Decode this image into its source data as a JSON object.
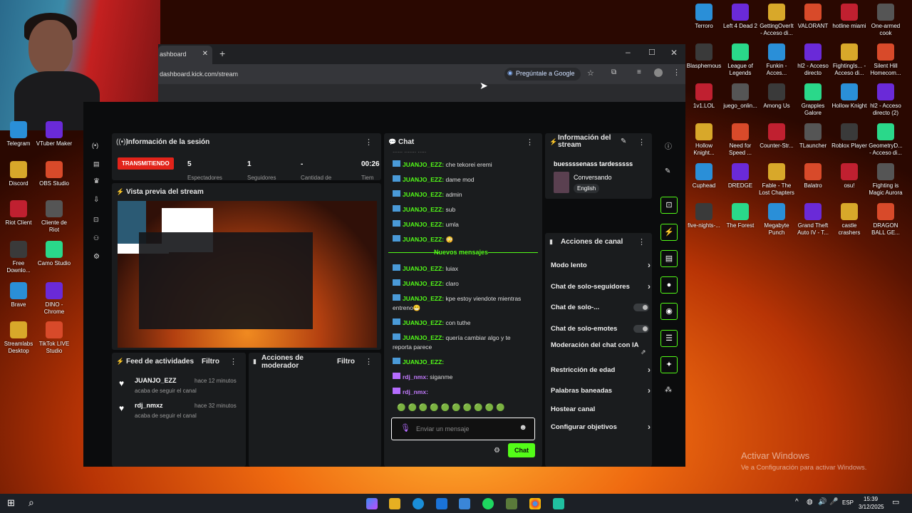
{
  "browser": {
    "tab_title": "ashboard",
    "url": "dashboard.kick.com/stream",
    "google_btn": "Pregúntale a Google"
  },
  "session": {
    "title": "Información de la sesión",
    "live_badge": "TRANSMITIENDO",
    "stats": [
      "5",
      "1",
      "-",
      "00:26"
    ],
    "stat_labels": [
      "Espectadores",
      "Seguidores",
      "Cantidad de",
      "Tiem"
    ]
  },
  "preview": {
    "title": "Vista previa del stream"
  },
  "feed": {
    "title": "Feed de actividades",
    "filter": "Filtro",
    "items": [
      {
        "user": "JUANJO_EZZ",
        "time": "hace 12 minutos",
        "text": "acaba de seguir el canal"
      },
      {
        "user": "rdj_nmxz",
        "time": "hace 32 minutos",
        "text": "acaba de seguir el canal"
      }
    ]
  },
  "mod": {
    "title": "Acciones de moderador",
    "filter": "Filtro"
  },
  "chat": {
    "title": "Chat",
    "top_fragment": "...... ....... .....",
    "new_messages": "Nuevos mensajes",
    "input_placeholder": "Enviar un mensaje",
    "send": "Chat",
    "messages": [
      {
        "user": "JUANJO_EZZ:",
        "text": "che tekorei eremi"
      },
      {
        "user": "JUANJO_EZZ:",
        "text": "dame mod"
      },
      {
        "user": "JUANJO_EZZ:",
        "text": "admin"
      },
      {
        "user": "JUANJO_EZZ:",
        "text": "sub"
      },
      {
        "user": "JUANJO_EZZ:",
        "text": "umla"
      },
      {
        "user": "JUANJO_EZZ:",
        "text": "😳"
      },
      {
        "user": "JUANJO_EZZ:",
        "text": "luiax"
      },
      {
        "user": "JUANJO_EZZ:",
        "text": "claro"
      },
      {
        "user": "JUANJO_EZZ:",
        "text": "kpe estoy viendote mientras"
      },
      {
        "user": "",
        "text": "entreno😁"
      },
      {
        "user": "JUANJO_EZZ:",
        "text": "con tuthe"
      },
      {
        "user": "JUANJO_EZZ:",
        "text": "quería cambiar algo y te"
      },
      {
        "user": "",
        "text": "reporta parece"
      },
      {
        "user": "JUANJO_EZZ:",
        "text": ""
      },
      {
        "user": "rdj_nmx:",
        "text": "siganme"
      },
      {
        "user": "rdj_nmx:",
        "text": ""
      }
    ]
  },
  "stream_info": {
    "title": "Información del stream",
    "stream_title": "buessssenass tardesssss",
    "category": "Conversando",
    "language": "English"
  },
  "channel_actions": {
    "title": "Acciones de canal",
    "items": [
      "Modo lento",
      "Chat de solo-seguidores",
      "Chat de solo-...",
      "Chat de solo-emotes",
      "Moderación del chat con IA",
      "Restricción de edad",
      "Palabras baneadas",
      "Hostear canal",
      "Configurar objetivos"
    ]
  },
  "desktop": {
    "left": [
      "Telegram",
      "VTuber Maker",
      "Discord",
      "OBS Studio",
      "Riot Client",
      "Cliente de Riot",
      "Free Downlo...",
      "Camo Studio",
      "Brave",
      "DINO - Chrome",
      "Streamlabs Desktop",
      "TikTok LIVE Studio"
    ],
    "right": [
      "Terroro",
      "Left 4 Dead 2",
      "GettingOverIt - Acceso di...",
      "VALORANT",
      "hotline miami",
      "One-armed cook",
      "Blasphemous",
      "League of Legends",
      "Funkin - Acces...",
      "hl2 - Acceso directo",
      "FightingIs... - Acceso di...",
      "Silent Hill Homecom...",
      "1v1.LOL",
      "juego_onlin...",
      "Among Us",
      "Grapples Galore",
      "Hollow Knight",
      "hl2 - Acceso directo (2)",
      "Hollow Knight...",
      "Need for Speed ...",
      "Counter-Str...",
      "TLauncher",
      "Roblox Player",
      "GeometryD... - Acceso di...",
      "Cuphead",
      "DREDGE",
      "Fable - The Lost Chapters",
      "Balatro",
      "osu!",
      "Fighting is Magic Aurora",
      "five-nights-...",
      "The Forest",
      "Megabyte Punch",
      "Grand Theft Auto IV - T...",
      "castle crashers",
      "DRAGON BALL GE..."
    ]
  },
  "watermark": {
    "title": "Activar Windows",
    "sub": "Ve a Configuración para activar Windows."
  },
  "taskbar": {
    "lang": "ESP",
    "time": "15:39",
    "date": "3/12/2025"
  }
}
